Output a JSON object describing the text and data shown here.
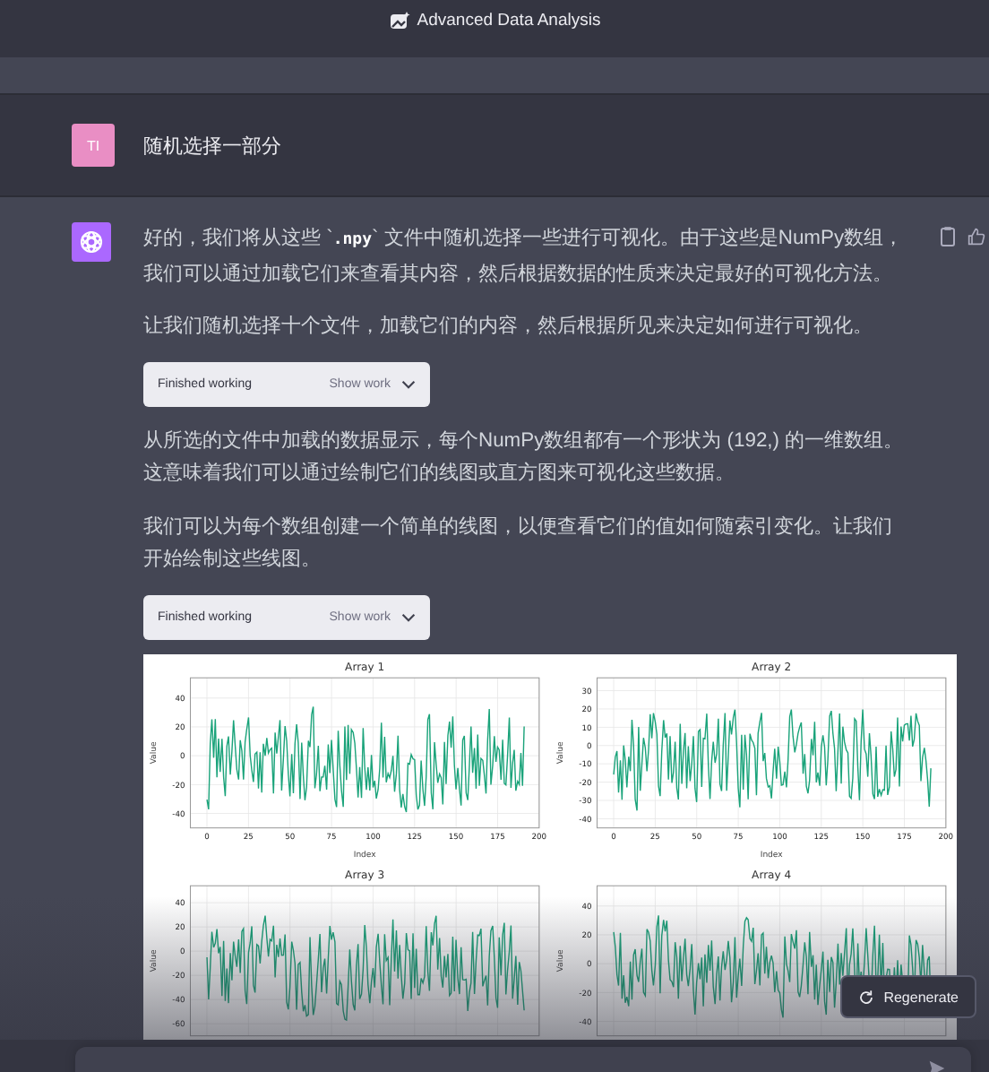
{
  "header": {
    "title": "Advanced Data Analysis"
  },
  "user_message": {
    "avatar": "TI",
    "text": "随机选择一部分"
  },
  "assistant_message": {
    "blocks": [
      {
        "kind": "paragraph",
        "parts": [
          {
            "text": "好的，我们将从这些 `",
            "code": false
          },
          {
            "text": ".npy",
            "code": true
          },
          {
            "text": "` 文件中随机选择一些进行可视化。由于这些是NumPy数组，我们可以通过加载它们来查看其内容，然后根据数据的性质来决定最好的可视化方法。",
            "code": false
          }
        ]
      },
      {
        "kind": "paragraph",
        "parts": [
          {
            "text": "让我们随机选择十个文件，加载它们的内容，然后根据所见来决定如何进行可视化。",
            "code": false
          }
        ]
      },
      {
        "kind": "tool",
        "status": "Finished working",
        "action": "Show work"
      },
      {
        "kind": "paragraph",
        "parts": [
          {
            "text": "从所选的文件中加载的数据显示，每个NumPy数组都有一个形状为 (192,) 的一维数组。这意味着我们可以通过绘制它们的线图或直方图来可视化这些数据。",
            "code": false
          }
        ]
      },
      {
        "kind": "paragraph",
        "parts": [
          {
            "text": "我们可以为每个数组创建一个简单的线图，以便查看它们的值如何随索引变化。让我们开始绘制这些线图。",
            "code": false
          }
        ]
      },
      {
        "kind": "tool",
        "status": "Finished working",
        "action": "Show work"
      },
      {
        "kind": "figure",
        "plots": [
          {
            "title": "Array 1",
            "ylabel": "Value",
            "xlabel": "Index",
            "yticks": [
              "40",
              "20",
              "0",
              "-20",
              "-40"
            ],
            "xticks": [
              "0",
              "25",
              "50",
              "75",
              "100",
              "125",
              "150",
              "175",
              "200"
            ]
          },
          {
            "title": "Array 2",
            "ylabel": "Value",
            "xlabel": "Index",
            "yticks": [
              "30",
              "20",
              "10",
              "0",
              "-10",
              "-20",
              "-30",
              "-40"
            ],
            "xticks": [
              "0",
              "25",
              "50",
              "75",
              "100",
              "125",
              "150",
              "175",
              "200"
            ]
          },
          {
            "title": "Array 3",
            "ylabel": "Value",
            "yticks": [
              "40",
              "20",
              "0",
              "-20",
              "-40",
              "-60"
            ]
          },
          {
            "title": "Array 4",
            "ylabel": "Value",
            "yticks": [
              "40",
              "20",
              "0",
              "-20",
              "-40"
            ]
          }
        ]
      }
    ]
  },
  "regenerate_button": "Regenerate"
}
